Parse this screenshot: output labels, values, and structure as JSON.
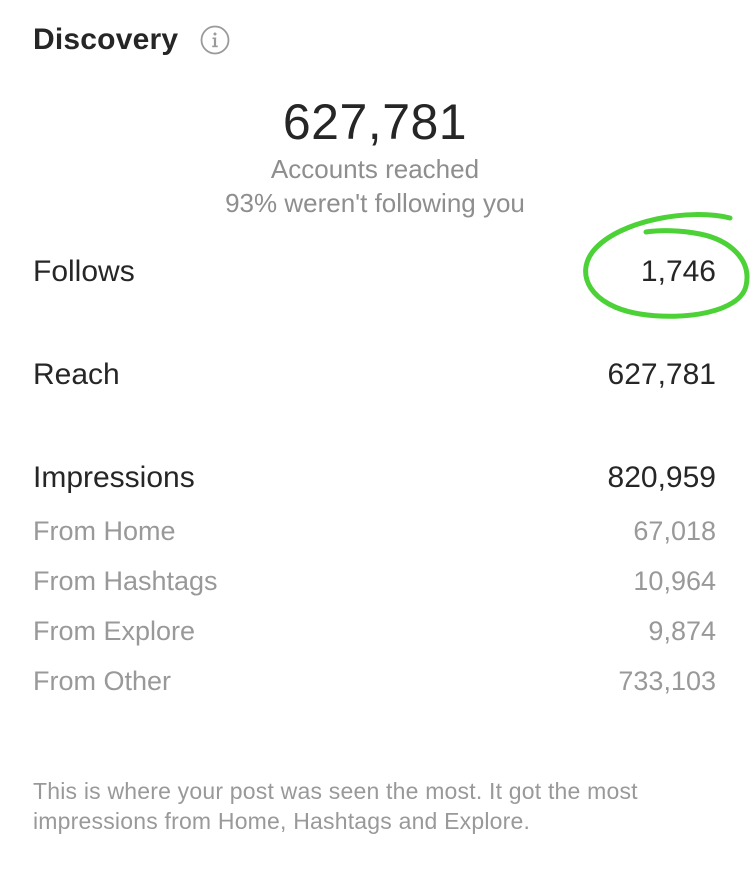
{
  "header": {
    "title": "Discovery",
    "info_icon": "info-icon"
  },
  "hero": {
    "number": "627,781",
    "caption": "Accounts reached",
    "subcaption": "93% weren't following you"
  },
  "stats": {
    "follows": {
      "label": "Follows",
      "value": "1,746"
    },
    "reach": {
      "label": "Reach",
      "value": "627,781"
    },
    "impressions": {
      "label": "Impressions",
      "value": "820,959"
    }
  },
  "impression_sources": [
    {
      "label": "From Home",
      "value": "67,018"
    },
    {
      "label": "From Hashtags",
      "value": "10,964"
    },
    {
      "label": "From Explore",
      "value": "9,874"
    },
    {
      "label": "From Other",
      "value": "733,103"
    }
  ],
  "footer": {
    "note": "This is where your post was seen the most. It got the most impressions from Home, Hashtags and Explore."
  },
  "colors": {
    "highlight_circle": "#4cd137",
    "muted_text": "#999999",
    "primary_text": "#262626"
  }
}
